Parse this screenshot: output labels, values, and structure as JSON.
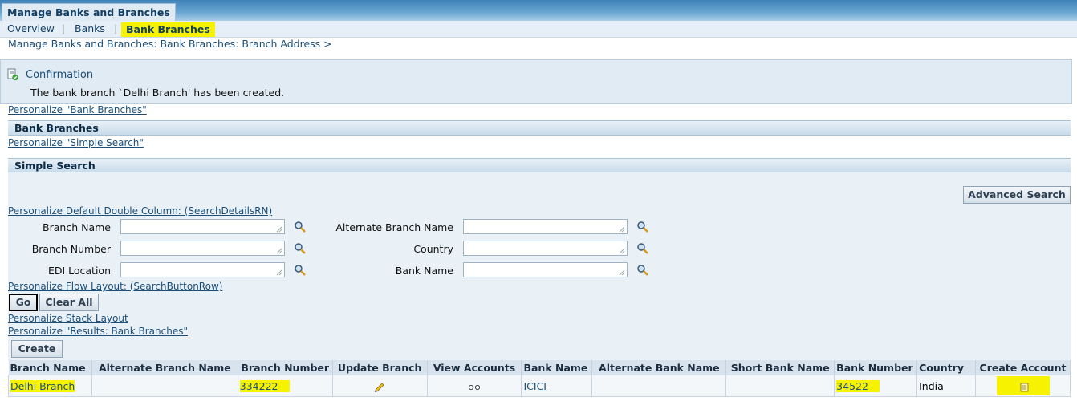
{
  "app": {
    "title_tab": "Manage Banks and Branches",
    "subnav": [
      "Overview",
      "Banks",
      "Bank Branches"
    ],
    "breadcrumb": "Manage Banks and Branches: Bank Branches: Branch Address  >"
  },
  "confirmation": {
    "heading": "Confirmation",
    "message": "The bank branch `Delhi Branch' has been created."
  },
  "links": {
    "personalize_bank_branches": "Personalize \"Bank Branches\"",
    "personalize_simple_search": "Personalize \"Simple Search\"",
    "personalize_double_column": "Personalize Default Double Column: (SearchDetailsRN)",
    "personalize_flow_layout": "Personalize Flow Layout: (SearchButtonRow)",
    "personalize_stack_layout": "Personalize Stack Layout",
    "personalize_results": "Personalize \"Results: Bank Branches\""
  },
  "sections": {
    "bank_branches": "Bank Branches",
    "simple_search": "Simple Search"
  },
  "search": {
    "advanced_button": "Advanced Search",
    "fields_left": [
      "Branch Name",
      "Branch Number",
      "EDI Location"
    ],
    "fields_right": [
      "Alternate Branch Name",
      "Country",
      "Bank Name"
    ],
    "go": "Go",
    "clear_all": "Clear All"
  },
  "results": {
    "create_button": "Create",
    "columns": [
      "Branch Name",
      "Alternate Branch Name",
      "Branch Number",
      "Update Branch",
      "View Accounts",
      "Bank Name",
      "Alternate Bank Name",
      "Short Bank Name",
      "Bank Number",
      "Country",
      "Create Account"
    ],
    "row": {
      "branch_name": "Delhi Branch",
      "alternate_branch_name": "",
      "branch_number": "334222",
      "bank_name": "ICICI",
      "alternate_bank_name": "",
      "short_bank_name": "",
      "bank_number": "34522",
      "country": "India"
    }
  },
  "colors": {
    "highlight": "#f6f200",
    "link": "#1b4f7a",
    "header_band": "#3f82b8"
  }
}
